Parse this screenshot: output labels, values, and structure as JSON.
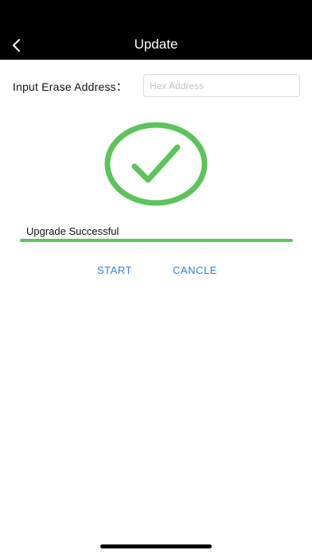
{
  "header": {
    "title": "Update",
    "back_icon": "chevron-left-icon"
  },
  "erase": {
    "label": "Input Erase Address：",
    "placeholder": "Hex Address",
    "value": ""
  },
  "status": {
    "icon": "check-circle-icon",
    "icon_color": "#5cc45a",
    "text": "Upgrade Successful",
    "progress_percent": 100
  },
  "actions": {
    "start_label": "START",
    "cancel_label": "CANCLE",
    "link_color": "#2f7ee8"
  }
}
